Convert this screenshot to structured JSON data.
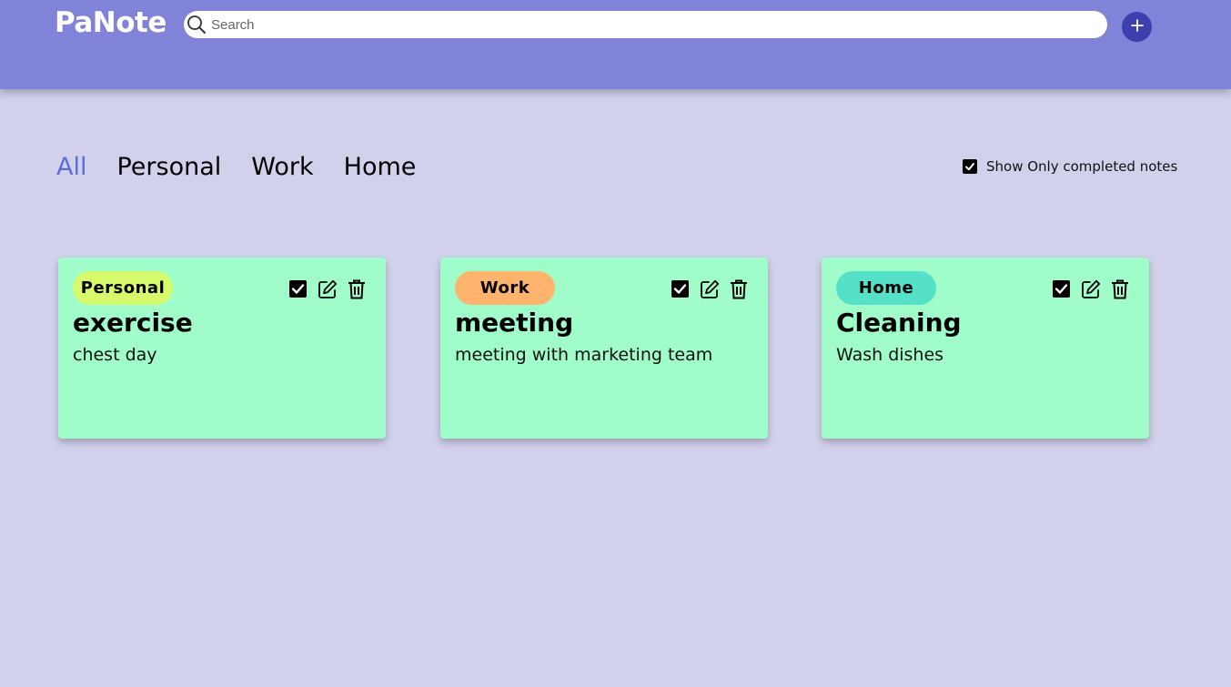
{
  "header": {
    "brand": "PaNote",
    "search_placeholder": "Search",
    "add_icon": "plus-icon",
    "background_color": "#8183d8"
  },
  "tabs": [
    {
      "label": "All",
      "active": true
    },
    {
      "label": "Personal",
      "active": false
    },
    {
      "label": "Work",
      "active": false
    },
    {
      "label": "Home",
      "active": false
    }
  ],
  "filter": {
    "label": "Show Only completed notes",
    "checked": true
  },
  "notes": [
    {
      "category": "Personal",
      "category_color": "#d7fa6c",
      "title": "exercise",
      "description": "chest day"
    },
    {
      "category": "Work",
      "category_color": "#ffb46e",
      "title": "meeting",
      "description": "meeting with marketing team"
    },
    {
      "category": "Home",
      "category_color": "#55e0c8",
      "title": "Cleaning",
      "description": "Wash dishes"
    }
  ],
  "colors": {
    "page_background": "#d1d1ec",
    "card_background": "#a0fcc9",
    "active_tab": "#5b6dde",
    "add_button": "#3e3fae"
  },
  "icons": [
    "search-icon",
    "plus-icon",
    "checkbox-icon",
    "edit-icon",
    "trash-icon"
  ]
}
